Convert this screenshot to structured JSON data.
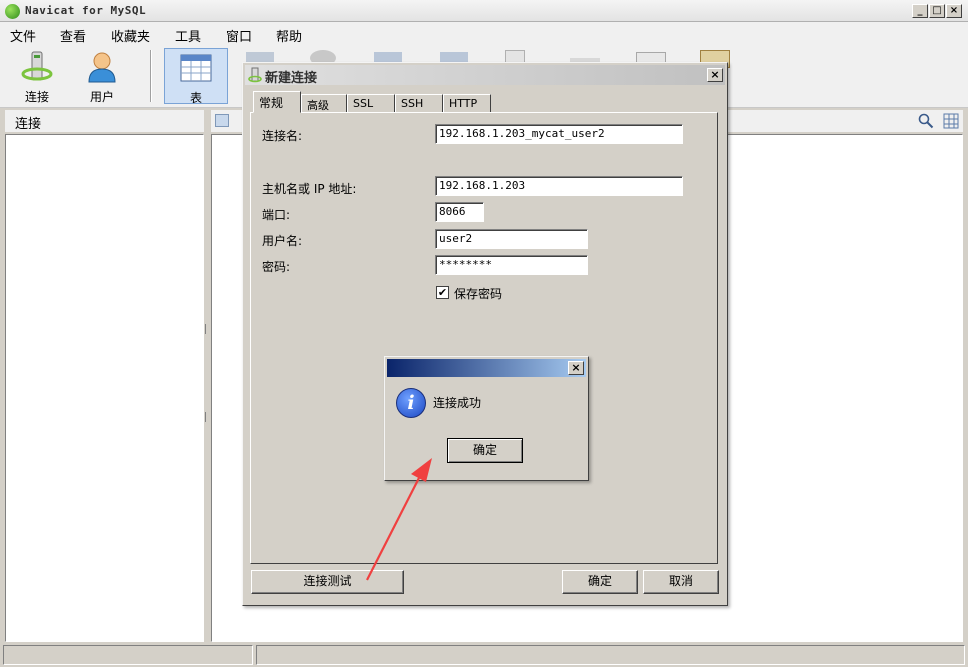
{
  "app": {
    "title": "Navicat for MySQL",
    "window_buttons": [
      "_",
      "□",
      "×"
    ]
  },
  "menu": [
    "文件",
    "查看",
    "收藏夹",
    "工具",
    "窗口",
    "帮助"
  ],
  "toolbar": [
    {
      "label": "连接",
      "icon": "connection-icon"
    },
    {
      "label": "用户",
      "icon": "user-icon"
    },
    {
      "label": "表",
      "icon": "table-icon",
      "selected": true
    }
  ],
  "left_panel": {
    "title": "连接"
  },
  "dialog": {
    "title": "新建连接",
    "close": "×",
    "tabs": [
      "常规",
      "高级",
      "SSL",
      "SSH",
      "HTTP"
    ],
    "fields": {
      "conn_name_label": "连接名:",
      "conn_name_value": "192.168.1.203_mycat_user2",
      "host_label": "主机名或 IP 地址:",
      "host_value": "192.168.1.203",
      "port_label": "端口:",
      "port_value": "8066",
      "user_label": "用户名:",
      "user_value": "user2",
      "password_label": "密码:",
      "password_value": "********",
      "save_password_label": "保存密码",
      "save_password_check": "✔"
    },
    "buttons": {
      "test": "连接测试",
      "ok": "确定",
      "cancel": "取消"
    }
  },
  "message_box": {
    "close": "×",
    "icon_glyph": "i",
    "text": "连接成功",
    "ok": "确定"
  },
  "colors": {
    "arrow": "#f04040",
    "msg_title_start": "#0a246a",
    "msg_title_end": "#a6caf0",
    "window_bg": "#d4d0c8"
  }
}
